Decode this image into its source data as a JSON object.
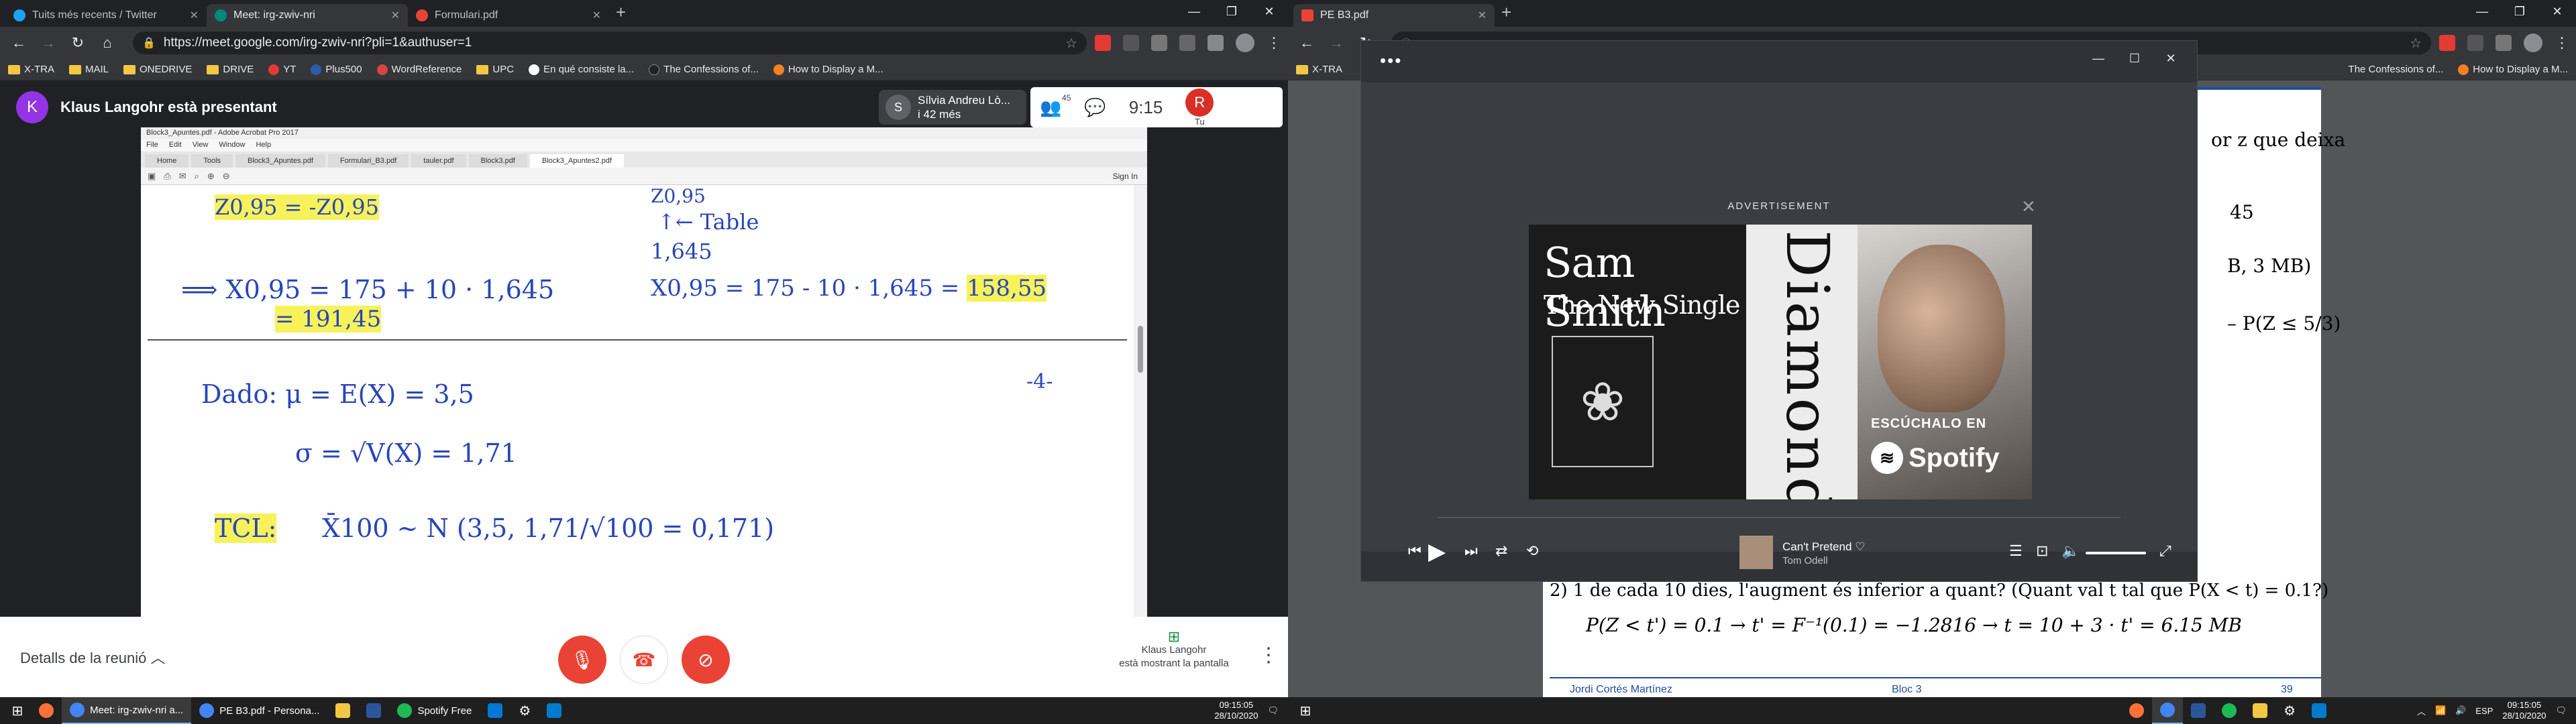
{
  "left_browser": {
    "tabs": [
      {
        "title": "Tuits més recents / Twitter",
        "color": "#1da1f2"
      },
      {
        "title": "Meet: irg-zwiv-nri",
        "color": "#00897b",
        "active": true
      },
      {
        "title": "Formulari.pdf",
        "color": "#ea4335"
      }
    ],
    "new_tab": "+",
    "url": "https://meet.google.com/irg-zwiv-nri?pli=1&authuser=1",
    "bookmarks": [
      "X-TRA",
      "MAIL",
      "ONEDRIVE",
      "DRIVE",
      "YT",
      "Plus500",
      "WordReference",
      "UPC",
      "En qué consiste la...",
      "The Confessions of...",
      "How to Display a M..."
    ]
  },
  "meet": {
    "presenter_initial": "K",
    "presenter_label": "Klaus Langohr està presentant",
    "participant_initial": "S",
    "participant_name": "Sílvia Andreu Lò...",
    "participant_more": "i 42 més",
    "people_count": "45",
    "clock": "9:15",
    "self_initial": "R",
    "self_label": "Tu",
    "details_label": "Detalls de la reunió",
    "presenting_name": "Klaus Langohr",
    "presenting_text": "està mostrant la pantalla"
  },
  "shared_pdf": {
    "window_title": "Block3_Apuntes.pdf - Adobe Acrobat Pro 2017",
    "menu": [
      "File",
      "Edit",
      "View",
      "Window",
      "Help"
    ],
    "tabs": [
      "Home",
      "Tools",
      "Block3_Apuntes.pdf",
      "Formulari_B3.pdf",
      "tauler.pdf",
      "Block3.pdf",
      "Block3_Apuntes2.pdf"
    ],
    "signin": "Sign In",
    "lines": {
      "z_eq": "Z0,95 = -Z0,95",
      "z095": "Z0,95",
      "table": "↑← Table",
      "val": "1,645",
      "x_plus": "⟹ X0,95 = 175 + 10 · 1,645",
      "x_plus_res": "= 191,45",
      "x_minus": "X0,95 = 175 - 10 · 1,645 =",
      "x_minus_res": "158,55",
      "page_no": "-4-",
      "dado": "Dado:  μ = E(X) = 3,5",
      "sigma": "σ = √V(X) = 1,71",
      "tcl": "TCL:",
      "tcl_expr": "X̄100 ~ N (3,5, 1,71/√100 = 0,171)"
    }
  },
  "right_browser": {
    "tab": "PE B3.pdf",
    "bookmarks_partial": [
      "X-TRA",
      "The Confessions of...",
      "How to Display a M..."
    ]
  },
  "pdf_right": {
    "frag1": "or z que deixa",
    "frag2": "45",
    "frag3": "B, 3 MB)",
    "frag4": "– P(Z ≤ 5/3)",
    "q2": "2)    1 de cada 10 dies, l'augment és inferior a quant? (Quant val t tal que P(X < t) = 0.1?)",
    "q2_sol": "P(Z < t') = 0.1 → t' = F⁻¹(0.1) = −1.2816 → t = 10 + 3 · t' = 6.15 MB",
    "footer_author": "Jordi Cortés Martínez",
    "footer_block": "Bloc 3",
    "footer_page": "39"
  },
  "spotify": {
    "ad_label": "ADVERTISEMENT",
    "artist": "Sam Smith",
    "single": "The New Single",
    "song_vertical": "Diamonds",
    "cta": "ESCÚCHALO EN",
    "brand": "Spotify",
    "track_name": "Can't Pretend",
    "track_artist": "Tom Odell"
  },
  "taskbar_left": {
    "items": [
      "Meet: irg-zwiv-nri a...",
      "PE B3.pdf - Persona...",
      "Spotify Free"
    ],
    "time": "09:15:05",
    "date": "28/10/2020"
  },
  "taskbar_right": {
    "lang": "ESP",
    "time": "09:15:05",
    "date": "28/10/2020"
  }
}
